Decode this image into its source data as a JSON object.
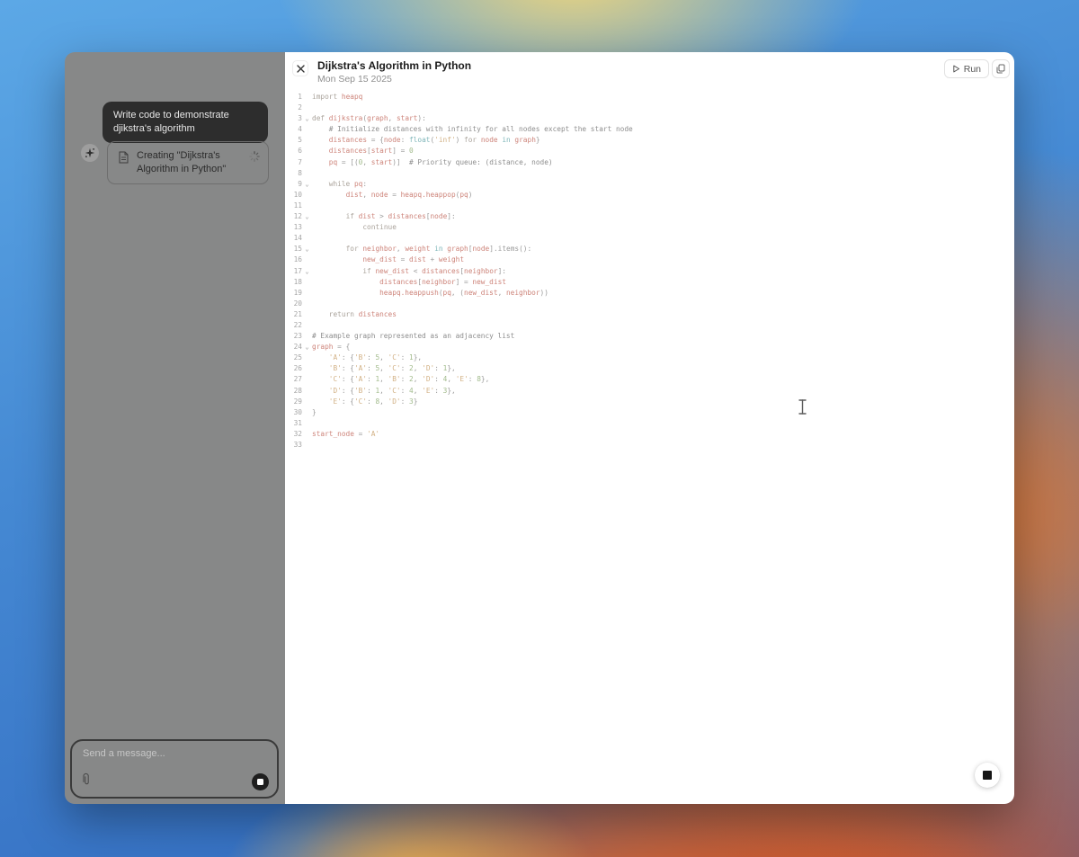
{
  "sidebar": {
    "user_message": "Write code to demonstrate djikstra's algorithm",
    "assistant": {
      "tool_card_label": "Creating \"Dijkstra's Algorithm in Python\""
    },
    "composer": {
      "placeholder": "Send a message..."
    }
  },
  "canvas": {
    "title": "Dijkstra's Algorithm in Python",
    "date": "Mon Sep 15 2025",
    "toolbar": {
      "run_label": "Run"
    },
    "code": {
      "language": "python",
      "fold_lines": [
        3,
        9,
        12,
        15,
        17,
        24
      ],
      "syntax_colors": {
        "kw": "#aaa39b",
        "pl": "#9a9a9a",
        "var": "#cd8379",
        "tl": "#7db5b8",
        "str": "#d2b185",
        "num": "#a2bb8c",
        "com": "#8d8d8d"
      },
      "lines": [
        [
          [
            "kw",
            "import"
          ],
          [
            "pl",
            " "
          ],
          [
            "var",
            "heapq"
          ]
        ],
        [],
        [
          [
            "kw",
            "def"
          ],
          [
            "pl",
            " "
          ],
          [
            "var",
            "dijkstra"
          ],
          [
            "pl",
            "("
          ],
          [
            "var",
            "graph"
          ],
          [
            "pl",
            ", "
          ],
          [
            "var",
            "start"
          ],
          [
            "pl",
            "):"
          ]
        ],
        [
          [
            "com",
            "    # Initialize distances with infinity for all nodes except the start node"
          ]
        ],
        [
          [
            "pl",
            "    "
          ],
          [
            "var",
            "distances"
          ],
          [
            "pl",
            " = {"
          ],
          [
            "var",
            "node"
          ],
          [
            "pl",
            ": "
          ],
          [
            "tl",
            "float"
          ],
          [
            "pl",
            "("
          ],
          [
            "str",
            "'inf'"
          ],
          [
            "pl",
            ") "
          ],
          [
            "kw",
            "for"
          ],
          [
            "pl",
            " "
          ],
          [
            "var",
            "node"
          ],
          [
            "pl",
            " "
          ],
          [
            "tl",
            "in"
          ],
          [
            "pl",
            " "
          ],
          [
            "var",
            "graph"
          ],
          [
            "pl",
            "}"
          ]
        ],
        [
          [
            "pl",
            "    "
          ],
          [
            "var",
            "distances"
          ],
          [
            "pl",
            "["
          ],
          [
            "var",
            "start"
          ],
          [
            "pl",
            "] = "
          ],
          [
            "num",
            "0"
          ]
        ],
        [
          [
            "pl",
            "    "
          ],
          [
            "var",
            "pq"
          ],
          [
            "pl",
            " = [("
          ],
          [
            "num",
            "0"
          ],
          [
            "pl",
            ", "
          ],
          [
            "var",
            "start"
          ],
          [
            "pl",
            ")]  "
          ],
          [
            "com",
            "# Priority queue: (distance, node)"
          ]
        ],
        [],
        [
          [
            "pl",
            "    "
          ],
          [
            "kw",
            "while"
          ],
          [
            "pl",
            " "
          ],
          [
            "var",
            "pq"
          ],
          [
            "pl",
            ":"
          ]
        ],
        [
          [
            "pl",
            "        "
          ],
          [
            "var",
            "dist"
          ],
          [
            "pl",
            ", "
          ],
          [
            "var",
            "node"
          ],
          [
            "pl",
            " = "
          ],
          [
            "var",
            "heapq.heappop"
          ],
          [
            "pl",
            "("
          ],
          [
            "var",
            "pq"
          ],
          [
            "pl",
            ")"
          ]
        ],
        [],
        [
          [
            "pl",
            "        "
          ],
          [
            "kw",
            "if"
          ],
          [
            "pl",
            " "
          ],
          [
            "var",
            "dist"
          ],
          [
            "pl",
            " > "
          ],
          [
            "var",
            "distances"
          ],
          [
            "pl",
            "["
          ],
          [
            "var",
            "node"
          ],
          [
            "pl",
            "]:"
          ]
        ],
        [
          [
            "pl",
            "            "
          ],
          [
            "kw",
            "continue"
          ]
        ],
        [],
        [
          [
            "pl",
            "        "
          ],
          [
            "kw",
            "for"
          ],
          [
            "pl",
            " "
          ],
          [
            "var",
            "neighbor"
          ],
          [
            "pl",
            ", "
          ],
          [
            "var",
            "weight"
          ],
          [
            "pl",
            " "
          ],
          [
            "tl",
            "in"
          ],
          [
            "pl",
            " "
          ],
          [
            "var",
            "graph"
          ],
          [
            "pl",
            "["
          ],
          [
            "var",
            "node"
          ],
          [
            "pl",
            "].items():"
          ]
        ],
        [
          [
            "pl",
            "            "
          ],
          [
            "var",
            "new_dist"
          ],
          [
            "pl",
            " = "
          ],
          [
            "var",
            "dist"
          ],
          [
            "pl",
            " + "
          ],
          [
            "var",
            "weight"
          ]
        ],
        [
          [
            "pl",
            "            "
          ],
          [
            "kw",
            "if"
          ],
          [
            "pl",
            " "
          ],
          [
            "var",
            "new_dist"
          ],
          [
            "pl",
            " < "
          ],
          [
            "var",
            "distances"
          ],
          [
            "pl",
            "["
          ],
          [
            "var",
            "neighbor"
          ],
          [
            "pl",
            "]:"
          ]
        ],
        [
          [
            "pl",
            "                "
          ],
          [
            "var",
            "distances"
          ],
          [
            "pl",
            "["
          ],
          [
            "var",
            "neighbor"
          ],
          [
            "pl",
            "] = "
          ],
          [
            "var",
            "new_dist"
          ]
        ],
        [
          [
            "pl",
            "                "
          ],
          [
            "var",
            "heapq.heappush"
          ],
          [
            "pl",
            "("
          ],
          [
            "var",
            "pq"
          ],
          [
            "pl",
            ", ("
          ],
          [
            "var",
            "new_dist"
          ],
          [
            "pl",
            ", "
          ],
          [
            "var",
            "neighbor"
          ],
          [
            "pl",
            "))"
          ]
        ],
        [],
        [
          [
            "pl",
            "    "
          ],
          [
            "kw",
            "return"
          ],
          [
            "pl",
            " "
          ],
          [
            "var",
            "distances"
          ]
        ],
        [],
        [
          [
            "com",
            "# Example graph represented as an adjacency list"
          ]
        ],
        [
          [
            "var",
            "graph"
          ],
          [
            "pl",
            " = {"
          ]
        ],
        [
          [
            "pl",
            "    "
          ],
          [
            "str",
            "'A'"
          ],
          [
            "pl",
            ": {"
          ],
          [
            "str",
            "'B'"
          ],
          [
            "pl",
            ": "
          ],
          [
            "num",
            "5"
          ],
          [
            "pl",
            ", "
          ],
          [
            "str",
            "'C'"
          ],
          [
            "pl",
            ": "
          ],
          [
            "num",
            "1"
          ],
          [
            "pl",
            "},"
          ]
        ],
        [
          [
            "pl",
            "    "
          ],
          [
            "str",
            "'B'"
          ],
          [
            "pl",
            ": {"
          ],
          [
            "str",
            "'A'"
          ],
          [
            "pl",
            ": "
          ],
          [
            "num",
            "5"
          ],
          [
            "pl",
            ", "
          ],
          [
            "str",
            "'C'"
          ],
          [
            "pl",
            ": "
          ],
          [
            "num",
            "2"
          ],
          [
            "pl",
            ", "
          ],
          [
            "str",
            "'D'"
          ],
          [
            "pl",
            ": "
          ],
          [
            "num",
            "1"
          ],
          [
            "pl",
            "},"
          ]
        ],
        [
          [
            "pl",
            "    "
          ],
          [
            "str",
            "'C'"
          ],
          [
            "pl",
            ": {"
          ],
          [
            "str",
            "'A'"
          ],
          [
            "pl",
            ": "
          ],
          [
            "num",
            "1"
          ],
          [
            "pl",
            ", "
          ],
          [
            "str",
            "'B'"
          ],
          [
            "pl",
            ": "
          ],
          [
            "num",
            "2"
          ],
          [
            "pl",
            ", "
          ],
          [
            "str",
            "'D'"
          ],
          [
            "pl",
            ": "
          ],
          [
            "num",
            "4"
          ],
          [
            "pl",
            ", "
          ],
          [
            "str",
            "'E'"
          ],
          [
            "pl",
            ": "
          ],
          [
            "num",
            "8"
          ],
          [
            "pl",
            "},"
          ]
        ],
        [
          [
            "pl",
            "    "
          ],
          [
            "str",
            "'D'"
          ],
          [
            "pl",
            ": {"
          ],
          [
            "str",
            "'B'"
          ],
          [
            "pl",
            ": "
          ],
          [
            "num",
            "1"
          ],
          [
            "pl",
            ", "
          ],
          [
            "str",
            "'C'"
          ],
          [
            "pl",
            ": "
          ],
          [
            "num",
            "4"
          ],
          [
            "pl",
            ", "
          ],
          [
            "str",
            "'E'"
          ],
          [
            "pl",
            ": "
          ],
          [
            "num",
            "3"
          ],
          [
            "pl",
            "},"
          ]
        ],
        [
          [
            "pl",
            "    "
          ],
          [
            "str",
            "'E'"
          ],
          [
            "pl",
            ": {"
          ],
          [
            "str",
            "'C'"
          ],
          [
            "pl",
            ": "
          ],
          [
            "num",
            "8"
          ],
          [
            "pl",
            ", "
          ],
          [
            "str",
            "'D'"
          ],
          [
            "pl",
            ": "
          ],
          [
            "num",
            "3"
          ],
          [
            "pl",
            "}"
          ]
        ],
        [
          [
            "pl",
            "}"
          ]
        ],
        [],
        [
          [
            "var",
            "start_node"
          ],
          [
            "pl",
            " = "
          ],
          [
            "str",
            "'A'"
          ]
        ],
        []
      ]
    }
  },
  "icons": {
    "fold_glyph": "⌄",
    "sparkle_glyph": "✦"
  }
}
